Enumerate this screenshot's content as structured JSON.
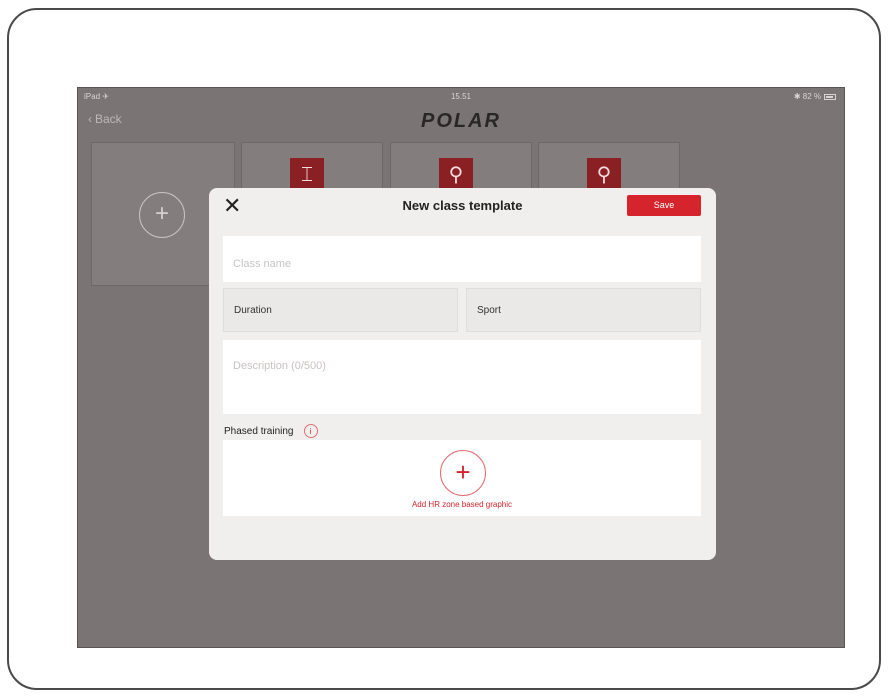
{
  "status": {
    "carrier": "iPad ✈",
    "time": "15.51",
    "battery": "✱ 82 %"
  },
  "nav": {
    "back_label": "Back",
    "logo": "POLAR"
  },
  "background": {
    "add_icon": "plus-icon",
    "sport_icons": [
      "strength-training-icon",
      "running-icon",
      "running-icon"
    ]
  },
  "modal": {
    "title": "New class template",
    "save_label": "Save",
    "class_name_placeholder": "Class name",
    "duration_label": "Duration",
    "sport_label": "Sport",
    "description_placeholder": "Description (0/500)",
    "phased_training_label": "Phased training",
    "add_hr_label": "Add HR zone based graphic"
  },
  "colors": {
    "accent": "#d5242c",
    "overlay": "#7a7574",
    "modal_bg": "#f1efee"
  }
}
